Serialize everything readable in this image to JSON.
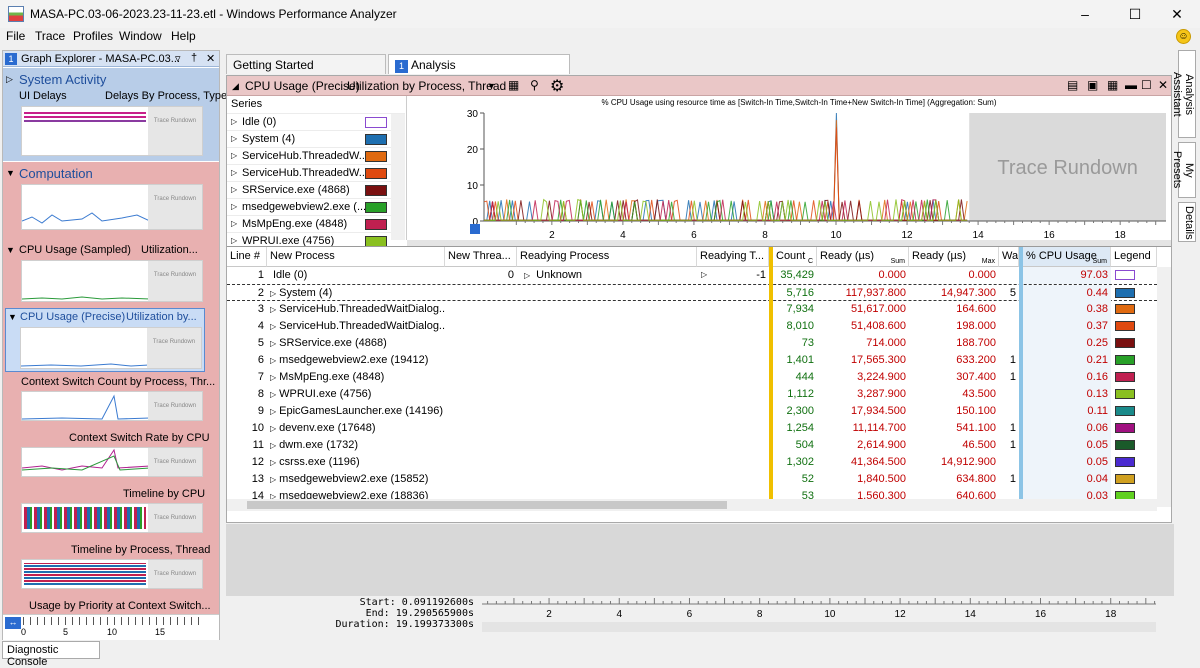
{
  "window": {
    "title": "MASA-PC.03-06-2023.23-11-23.etl - Windows Performance Analyzer"
  },
  "menu": [
    "File",
    "Trace",
    "Profiles",
    "Window",
    "Help"
  ],
  "graph_explorer": {
    "number": "1",
    "title": "Graph Explorer - MASA-PC.03...",
    "system_activity": {
      "label": "System Activity",
      "sub_left": "UI Delays",
      "sub_right": "Delays By Process, Type"
    },
    "computation": {
      "label": "Computation"
    },
    "cpu_sampled": {
      "left": "CPU Usage (Sampled)",
      "right": "Utilization..."
    },
    "cpu_precise": {
      "left": "CPU Usage (Precise)",
      "right": "Utilization by..."
    },
    "graphs": [
      "Context Switch Count by Process, Thr...",
      "Context Switch Rate by CPU",
      "Timeline by CPU",
      "Timeline by Process, Thread",
      "Usage by Priority at Context Switch..."
    ],
    "thumb_label": "Trace Rundown",
    "axis": [
      "0",
      "5",
      "10",
      "15"
    ]
  },
  "tabs": [
    {
      "label": "Getting Started"
    },
    {
      "num": "1",
      "label": "Analysis"
    }
  ],
  "panel": {
    "title": "CPU Usage (Precise)",
    "preset": "Utilization by Process, Thread"
  },
  "series_header": "Series",
  "series": [
    {
      "label": "Idle (0)",
      "color": "#ffffff"
    },
    {
      "label": "System (4)",
      "color": "#1e6fb0"
    },
    {
      "label": "ServiceHub.ThreadedW...",
      "color": "#e06a10"
    },
    {
      "label": "ServiceHub.ThreadedW...",
      "color": "#e04a10"
    },
    {
      "label": "SRService.exe (4868)",
      "color": "#7a1010"
    },
    {
      "label": "msedgewebview2.exe (...",
      "color": "#28a028"
    },
    {
      "label": "MsMpEng.exe (4848)",
      "color": "#c02050"
    },
    {
      "label": "WPRUI.exe (4756)",
      "color": "#8ac020"
    }
  ],
  "chart_data": {
    "type": "line",
    "title": "% CPU Usage using resource time as [Switch-In Time,Switch-In Time+New Switch-In Time] (Aggregation: Sum)",
    "yticks": [
      "0",
      "10",
      "20",
      "30"
    ],
    "xticks": [
      "2",
      "4",
      "6",
      "8",
      "10",
      "12",
      "14",
      "16",
      "18"
    ],
    "ylim": [
      0,
      30
    ],
    "xlim": [
      0.09,
      19.29
    ],
    "overlay": "Trace Rundown",
    "peak": {
      "x": 10.0,
      "y": 30
    }
  },
  "table": {
    "headers": [
      "Line #",
      "New Process",
      "New Threa...",
      "Readying Process",
      "Readying T...",
      "Count",
      "Ready (µs)",
      "Ready (µs)",
      "Wai",
      "% CPU Usage",
      "Legend"
    ],
    "subheaders": {
      "count": "C",
      "ready_sum": "Sum",
      "ready_max": "Max",
      "cpu_sum": "Sum"
    },
    "rows": [
      {
        "line": "1",
        "proc": "Idle (0)",
        "newthread": "0",
        "rproc": "Unknown",
        "rthread": "-1",
        "count": "35,429",
        "ready": "0.000",
        "readymax": "0.000",
        "wait": "",
        "cpu": "97.03",
        "color": "#ffffff"
      },
      {
        "line": "2",
        "proc": "System (4)",
        "newthread": "",
        "rproc": "",
        "rthread": "",
        "count": "5,716",
        "ready": "117,937.800",
        "readymax": "14,947.300",
        "wait": "5",
        "cpu": "0.44",
        "color": "#1e6fb0"
      },
      {
        "line": "3",
        "proc": "ServiceHub.ThreadedWaitDialog...",
        "newthread": "",
        "rproc": "",
        "rthread": "",
        "count": "7,934",
        "ready": "51,617.000",
        "readymax": "164.600",
        "wait": "",
        "cpu": "0.38",
        "color": "#e06a10"
      },
      {
        "line": "4",
        "proc": "ServiceHub.ThreadedWaitDialog...",
        "newthread": "",
        "rproc": "",
        "rthread": "",
        "count": "8,010",
        "ready": "51,408.600",
        "readymax": "198.000",
        "wait": "",
        "cpu": "0.37",
        "color": "#e04a10"
      },
      {
        "line": "5",
        "proc": "SRService.exe (4868)",
        "newthread": "",
        "rproc": "",
        "rthread": "",
        "count": "73",
        "ready": "714.000",
        "readymax": "188.700",
        "wait": "",
        "cpu": "0.25",
        "color": "#7a1010"
      },
      {
        "line": "6",
        "proc": "msedgewebview2.exe (19412)",
        "newthread": "",
        "rproc": "",
        "rthread": "",
        "count": "1,401",
        "ready": "17,565.300",
        "readymax": "633.200",
        "wait": "1",
        "cpu": "0.21",
        "color": "#28a028"
      },
      {
        "line": "7",
        "proc": "MsMpEng.exe (4848)",
        "newthread": "",
        "rproc": "",
        "rthread": "",
        "count": "444",
        "ready": "3,224.900",
        "readymax": "307.400",
        "wait": "1",
        "cpu": "0.16",
        "color": "#c02050"
      },
      {
        "line": "8",
        "proc": "WPRUI.exe (4756)",
        "newthread": "",
        "rproc": "",
        "rthread": "",
        "count": "1,112",
        "ready": "3,287.900",
        "readymax": "43.500",
        "wait": "",
        "cpu": "0.13",
        "color": "#8ac020"
      },
      {
        "line": "9",
        "proc": "EpicGamesLauncher.exe (14196)",
        "newthread": "",
        "rproc": "",
        "rthread": "",
        "count": "2,300",
        "ready": "17,934.500",
        "readymax": "150.100",
        "wait": "",
        "cpu": "0.11",
        "color": "#1a8a8a"
      },
      {
        "line": "10",
        "proc": "devenv.exe (17648)",
        "newthread": "",
        "rproc": "",
        "rthread": "",
        "count": "1,254",
        "ready": "11,114.700",
        "readymax": "541.100",
        "wait": "1",
        "cpu": "0.06",
        "color": "#a01080"
      },
      {
        "line": "11",
        "proc": "dwm.exe (1732)",
        "newthread": "",
        "rproc": "",
        "rthread": "",
        "count": "504",
        "ready": "2,614.900",
        "readymax": "46.500",
        "wait": "1",
        "cpu": "0.05",
        "color": "#1a5a2a"
      },
      {
        "line": "12",
        "proc": "csrss.exe (1196)",
        "newthread": "",
        "rproc": "",
        "rthread": "",
        "count": "1,302",
        "ready": "41,364.500",
        "readymax": "14,912.900",
        "wait": "",
        "cpu": "0.05",
        "color": "#4a2ad0"
      },
      {
        "line": "13",
        "proc": "msedgewebview2.exe (15852)",
        "newthread": "",
        "rproc": "",
        "rthread": "",
        "count": "52",
        "ready": "1,840.500",
        "readymax": "634.800",
        "wait": "1",
        "cpu": "0.04",
        "color": "#d0a020"
      },
      {
        "line": "14",
        "proc": "msedgewebview2.exe (18836)",
        "newthread": "",
        "rproc": "",
        "rthread": "",
        "count": "53",
        "ready": "1,560.300",
        "readymax": "640.600",
        "wait": "",
        "cpu": "0.03",
        "color": "#60d020"
      }
    ]
  },
  "timeline": {
    "start_label": "Start:",
    "start": "0.091192600s",
    "end_label": "End:",
    "end": "19.290565900s",
    "duration_label": "Duration:",
    "duration": "19.199373300s"
  },
  "right_tabs": [
    "Analysis Assistant",
    "My Presets",
    "Details"
  ],
  "diagnostic": "Diagnostic Console"
}
